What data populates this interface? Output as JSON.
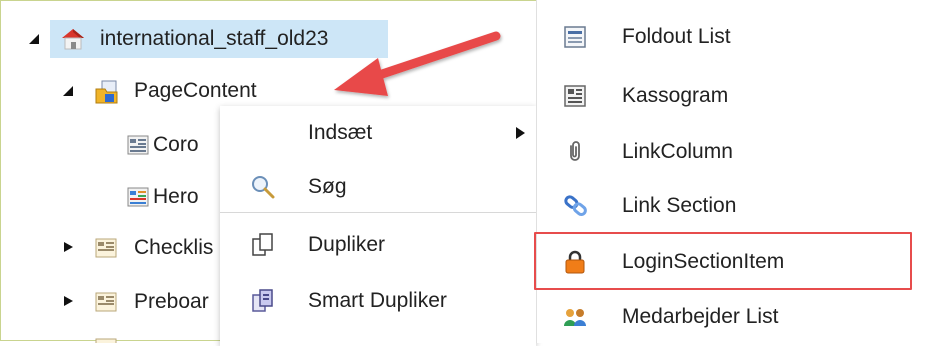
{
  "tree": {
    "items": [
      {
        "label": "international_staff_old23",
        "expanded": true,
        "selected": true,
        "icon": "house-icon"
      },
      {
        "label": "PageContent",
        "expanded": true,
        "icon": "folder-page-icon"
      },
      {
        "label": "Coro",
        "icon": "component-icon"
      },
      {
        "label": "Hero",
        "icon": "component-colored-icon"
      },
      {
        "label": "Checklis",
        "expanded": false,
        "icon": "component-icon"
      },
      {
        "label": "Preboar",
        "expanded": false,
        "icon": "component-icon"
      }
    ]
  },
  "context_menu": {
    "items": [
      {
        "label": "Indsæt",
        "icon": "",
        "has_submenu": true
      },
      {
        "label": "Søg",
        "icon": "search-icon"
      },
      {
        "label": "Dupliker",
        "icon": "duplicate-icon"
      },
      {
        "label": "Smart Dupliker",
        "icon": "smart-duplicate-icon"
      }
    ]
  },
  "submenu": {
    "items": [
      {
        "label": "Foldout List",
        "icon": "foldout-list-icon"
      },
      {
        "label": "Kassogram",
        "icon": "kassogram-icon"
      },
      {
        "label": "LinkColumn",
        "icon": "paperclip-icon"
      },
      {
        "label": "Link Section",
        "icon": "link-icon"
      },
      {
        "label": "LoginSectionItem",
        "icon": "padlock-icon",
        "highlighted": true
      },
      {
        "label": "Medarbejder List",
        "icon": "people-icon"
      }
    ]
  },
  "colors": {
    "selection": "#cde6f7",
    "annotation_red": "#e74c4c",
    "frame": "#c9d48f"
  }
}
